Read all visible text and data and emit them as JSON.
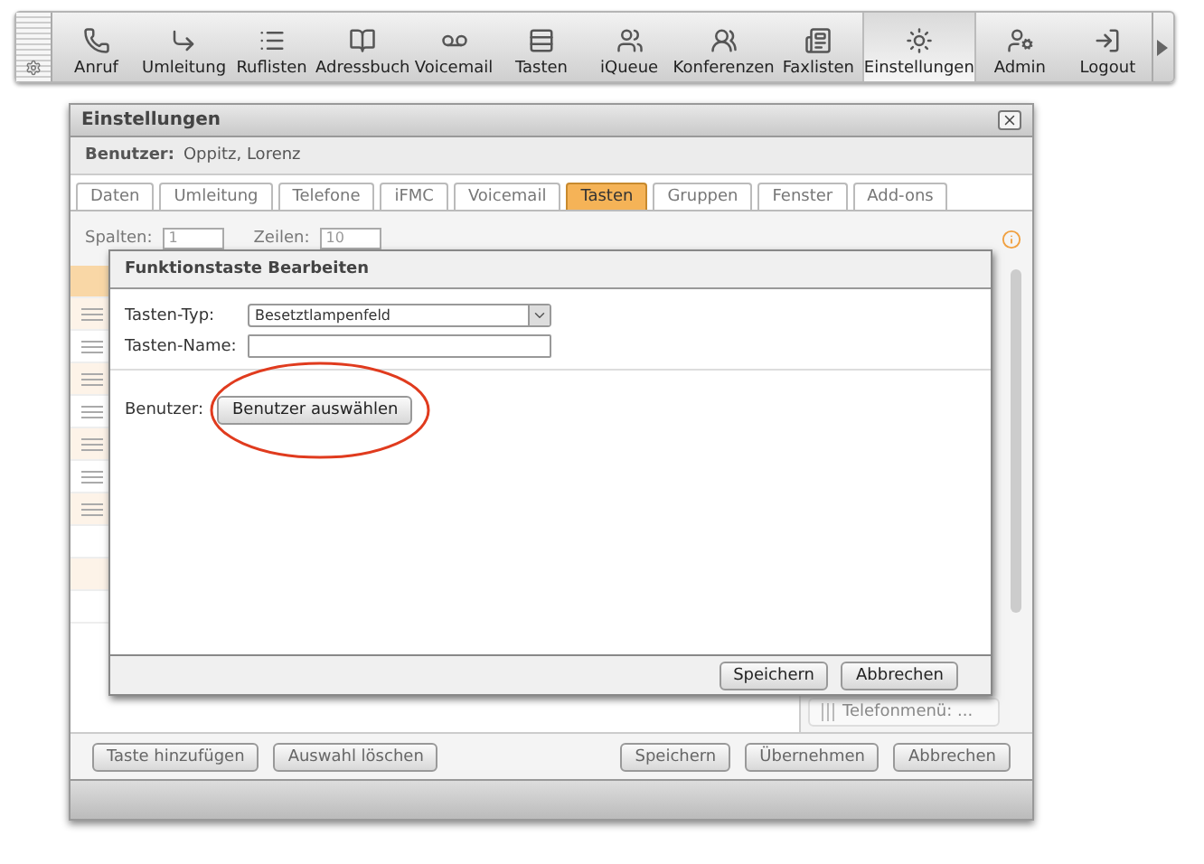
{
  "toolbar": {
    "items": [
      {
        "label": "Anruf",
        "selected": false
      },
      {
        "label": "Umleitung",
        "selected": false
      },
      {
        "label": "Ruflisten",
        "selected": false
      },
      {
        "label": "Adressbuch",
        "selected": false
      },
      {
        "label": "Voicemail",
        "selected": false
      },
      {
        "label": "Tasten",
        "selected": false
      },
      {
        "label": "iQueue",
        "selected": false
      },
      {
        "label": "Konferenzen",
        "selected": false
      },
      {
        "label": "Faxlisten",
        "selected": false
      },
      {
        "label": "Einstellungen",
        "selected": true
      },
      {
        "label": "Admin",
        "selected": false
      },
      {
        "label": "Logout",
        "selected": false
      }
    ]
  },
  "window": {
    "title": "Einstellungen",
    "user_label": "Benutzer:",
    "user_name": "Oppitz, Lorenz",
    "tabs": [
      {
        "label": "Daten",
        "selected": false
      },
      {
        "label": "Umleitung",
        "selected": false
      },
      {
        "label": "Telefone",
        "selected": false
      },
      {
        "label": "iFMC",
        "selected": false
      },
      {
        "label": "Voicemail",
        "selected": false
      },
      {
        "label": "Tasten",
        "selected": true
      },
      {
        "label": "Gruppen",
        "selected": false
      },
      {
        "label": "Fenster",
        "selected": false
      },
      {
        "label": "Add-ons",
        "selected": false
      }
    ],
    "options": {
      "columns_label": "Spalten:",
      "columns_value": "1",
      "rows_label": "Zeilen:",
      "rows_value": "10"
    },
    "key_rows": [
      {
        "kind": "header",
        "selected": true
      },
      {
        "kind": "key",
        "selected": false
      },
      {
        "kind": "key",
        "selected": false
      },
      {
        "kind": "key",
        "selected": false
      },
      {
        "kind": "key",
        "selected": false
      },
      {
        "kind": "key",
        "selected": false
      },
      {
        "kind": "key",
        "selected": false
      },
      {
        "kind": "key",
        "selected": false
      },
      {
        "kind": "empty",
        "selected": false
      },
      {
        "kind": "empty",
        "selected": false
      },
      {
        "kind": "empty",
        "selected": false
      }
    ],
    "side_item": "Telefonmenü: ...",
    "buttons_left": [
      "Taste hinzufügen",
      "Auswahl löschen"
    ],
    "buttons_right": [
      "Speichern",
      "Übernehmen",
      "Abbrechen"
    ]
  },
  "dialog": {
    "title": "Funktionstaste Bearbeiten",
    "type_label": "Tasten-Typ:",
    "type_value": "Besetztlampenfeld",
    "name_label": "Tasten-Name:",
    "user_label": "Benutzer:",
    "select_button": "Benutzer auswählen",
    "highlighted": true,
    "buttons": [
      "Speichern",
      "Abbrechen"
    ]
  }
}
